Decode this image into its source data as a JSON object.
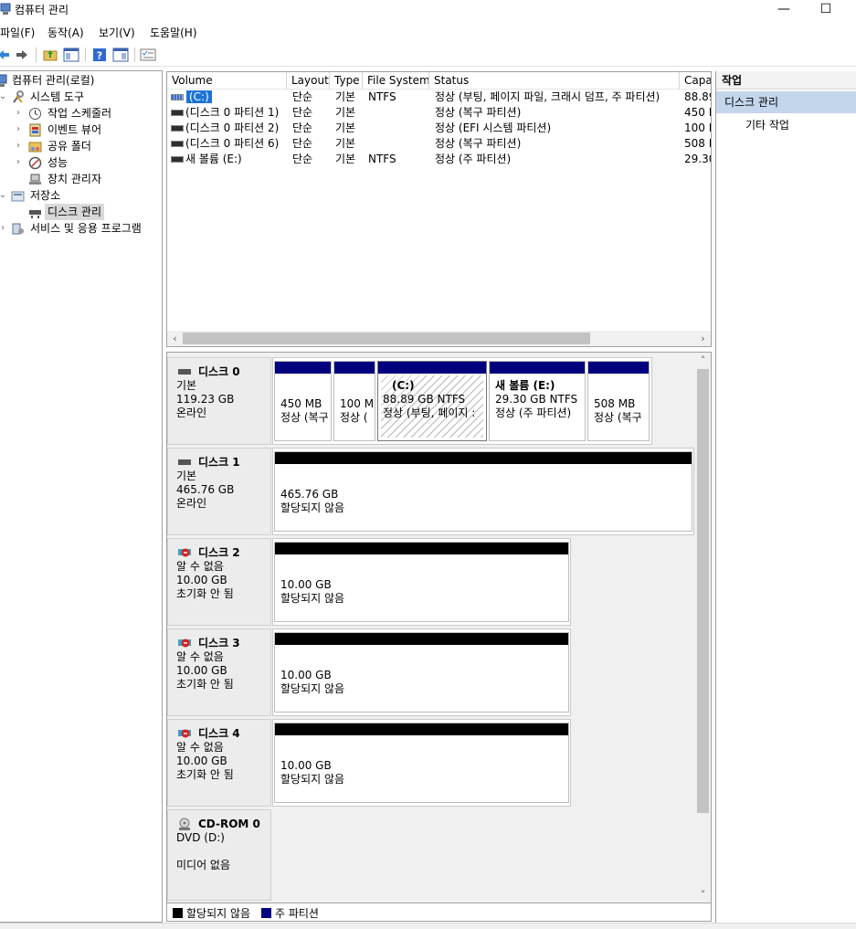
{
  "window": {
    "title": "컴퓨터 관리",
    "minimize_glyph": "—",
    "maximize_glyph": "☐"
  },
  "menu": [
    "파일(F)",
    "동작(A)",
    "보기(V)",
    "도움말(H)"
  ],
  "tree": {
    "root": "컴퓨터 관리(로컬)",
    "system_tools": "시스템 도구",
    "task_scheduler": "작업 스케줄러",
    "event_viewer": "이벤트 뷰어",
    "shared_folders": "공유 폴더",
    "performance": "성능",
    "device_manager": "장치 관리자",
    "storage": "저장소",
    "disk_management": "디스크 관리",
    "services_apps": "서비스 및 응용 프로그램"
  },
  "volume_list": {
    "columns": [
      "Volume",
      "Layout",
      "Type",
      "File System",
      "Status",
      "Capa"
    ],
    "rows": [
      {
        "volume": "(C:)",
        "layout": "단순",
        "type": "기본",
        "fs": "NTFS",
        "status": "정상 (부팅, 페이지 파일, 크래시 덤프, 주 파티션)",
        "capacity": "88.89"
      },
      {
        "volume": "(디스크 0 파티션 1)",
        "layout": "단순",
        "type": "기본",
        "fs": "",
        "status": "정상 (복구 파티션)",
        "capacity": "450 I"
      },
      {
        "volume": "(디스크 0 파티션 2)",
        "layout": "단순",
        "type": "기본",
        "fs": "",
        "status": "정상 (EFI 시스템 파티션)",
        "capacity": "100 I"
      },
      {
        "volume": "(디스크 0 파티션 6)",
        "layout": "단순",
        "type": "기본",
        "fs": "",
        "status": "정상 (복구 파티션)",
        "capacity": "508 I"
      },
      {
        "volume": "새 볼륨 (E:)",
        "layout": "단순",
        "type": "기본",
        "fs": "NTFS",
        "status": "정상 (주 파티션)",
        "capacity": "29.30"
      }
    ]
  },
  "disks": {
    "disk0": {
      "name": "디스크 0",
      "type": "기본",
      "size": "119.23 GB",
      "state": "온라인",
      "parts": [
        {
          "title": "",
          "line1": "450 MB",
          "line2": "정상 (복구"
        },
        {
          "title": "",
          "line1": "100 M",
          "line2": "정상 ("
        },
        {
          "title": "(C:)",
          "line1": "88.89 GB NTFS",
          "line2": "정상 (부팅, 페이지 :"
        },
        {
          "title": "새 볼륨  (E:)",
          "line1": "29.30 GB NTFS",
          "line2": "정상 (주 파티션)"
        },
        {
          "title": "",
          "line1": "508 MB",
          "line2": "정상 (복구"
        }
      ]
    },
    "disk1": {
      "name": "디스크 1",
      "type": "기본",
      "size": "465.76 GB",
      "state": "온라인",
      "part_size": "465.76 GB",
      "part_state": "할당되지 않음"
    },
    "disk2": {
      "name": "디스크 2",
      "type": "알 수 없음",
      "size": "10.00 GB",
      "state": "초기화 안 됨",
      "part_size": "10.00 GB",
      "part_state": "할당되지 않음"
    },
    "disk3": {
      "name": "디스크 3",
      "type": "알 수 없음",
      "size": "10.00 GB",
      "state": "초기화 안 됨",
      "part_size": "10.00 GB",
      "part_state": "할당되지 않음"
    },
    "disk4": {
      "name": "디스크 4",
      "type": "알 수 없음",
      "size": "10.00 GB",
      "state": "초기화 안 됨",
      "part_size": "10.00 GB",
      "part_state": "할당되지 않음"
    },
    "cdrom0": {
      "name": "CD-ROM 0",
      "type": "DVD (D:)",
      "state": "미디어 없음"
    }
  },
  "legend": {
    "unallocated": "할당되지 않음",
    "primary": "주 파티션",
    "unallocated_color": "#000000",
    "primary_color": "#00007f"
  },
  "actions": {
    "header": "작업",
    "section": "디스크 관리",
    "more": "기타 작업"
  }
}
